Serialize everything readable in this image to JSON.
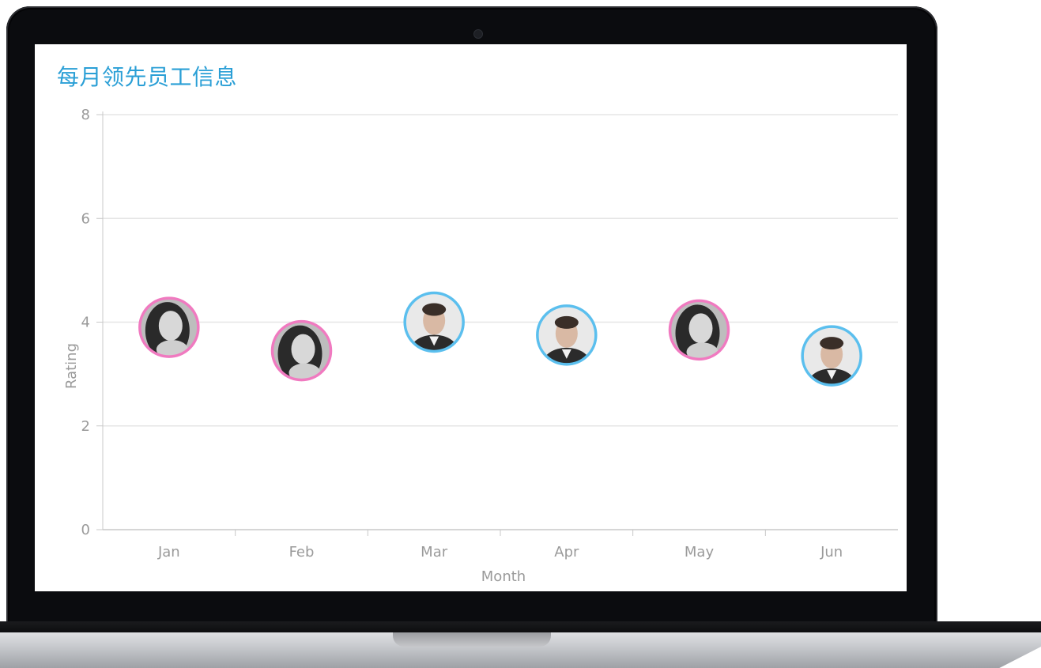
{
  "chart_data": {
    "type": "scatter",
    "title": "每月领先员工信息",
    "xlabel": "Month",
    "ylabel": "Rating",
    "ylim": [
      0,
      8
    ],
    "yticks": [
      0,
      2,
      4,
      6,
      8
    ],
    "categories": [
      "Jan",
      "Feb",
      "Mar",
      "Apr",
      "May",
      "Jun"
    ],
    "values": [
      3.9,
      3.45,
      4.0,
      3.75,
      3.85,
      3.35
    ],
    "grid": true,
    "marker_colors": [
      "#f07ac0",
      "#f07ac0",
      "#5bbfee",
      "#5bbfee",
      "#f07ac0",
      "#5bbfee"
    ],
    "marker_icons": [
      "avatar-woman",
      "avatar-woman",
      "avatar-man",
      "avatar-man",
      "avatar-woman",
      "avatar-man"
    ]
  },
  "colors": {
    "title": "#2a9fd6",
    "female_ring": "#f07ac0",
    "male_ring": "#5bbfee",
    "grid": "#e6e6e6",
    "axis_text": "#9a9a9a"
  }
}
